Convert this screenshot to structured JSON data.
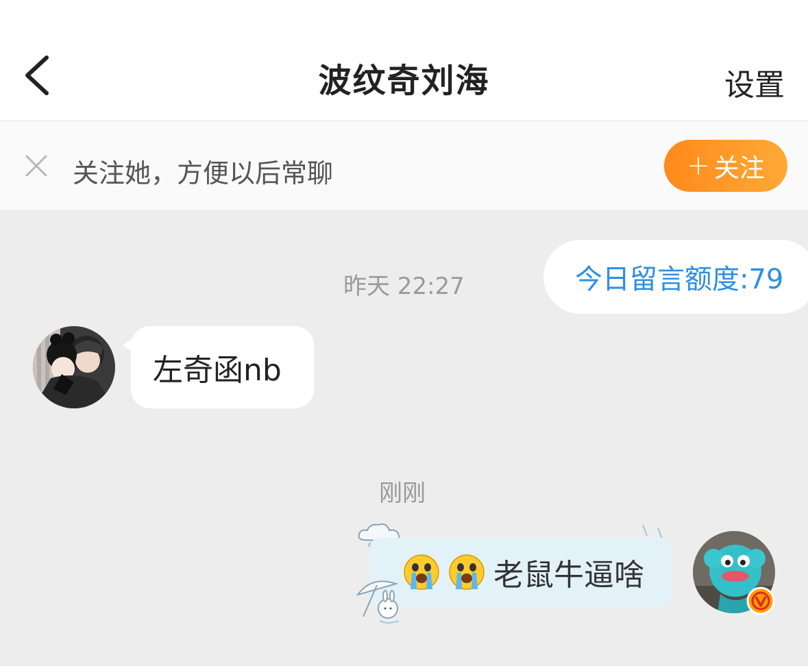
{
  "header": {
    "title": "波纹奇刘海",
    "settings_label": "设置"
  },
  "follow_bar": {
    "text": "关注她，方便以后常聊",
    "button_label": "关注",
    "button_plus": "+"
  },
  "quota": {
    "label": "今日留言额度:79"
  },
  "messages": [
    {
      "timestamp": "昨天 22:27",
      "sender": "other",
      "text": "左奇函nb"
    },
    {
      "timestamp": "刚刚",
      "sender": "me",
      "text": "老鼠牛逼啥",
      "emojis": [
        "crying-emoji",
        "crying-emoji"
      ]
    }
  ],
  "colors": {
    "accent_orange": "#ff8a1a",
    "quota_blue": "#2d8fe3",
    "background": "#ededed",
    "vip_badge": "#ff9c00"
  },
  "icons": [
    "back-arrow-icon",
    "close-icon",
    "crying-emoji",
    "vip-badge-icon"
  ]
}
